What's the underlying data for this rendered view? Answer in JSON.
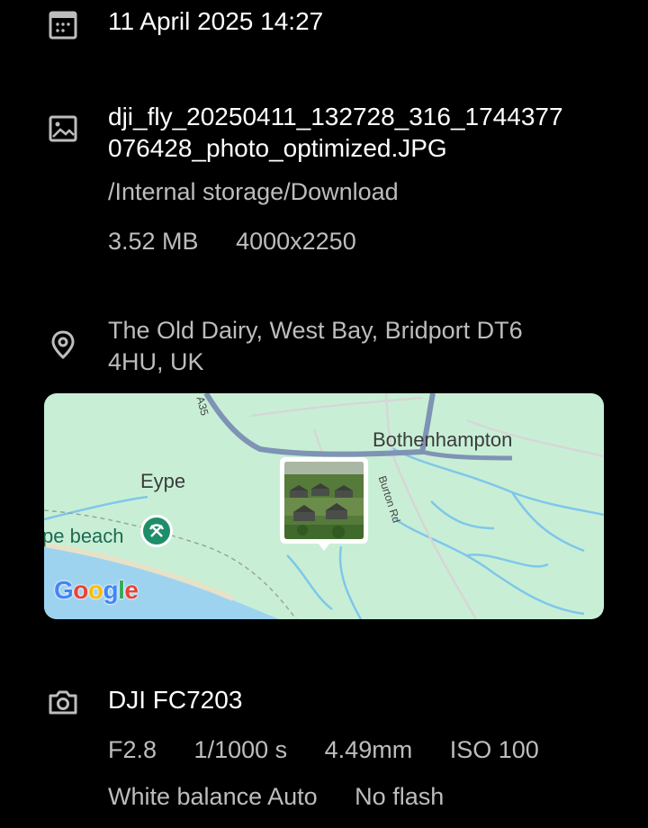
{
  "datetime": "11 April 2025 14:27",
  "file": {
    "name_line1": "dji_fly_20250411_132728_316_1744377",
    "name_line2": "076428_photo_optimized.JPG",
    "path": "/Internal storage/Download",
    "size": "3.52 MB",
    "resolution": "4000x2250"
  },
  "location": {
    "address_line1": "The Old Dairy, West Bay, Bridport DT6",
    "address_line2": "4HU, UK",
    "map_labels": {
      "bothenhampton": "Bothenhampton",
      "eype": "Eype",
      "beach": "pe beach",
      "road": "Burton Rd",
      "a35": "A35"
    },
    "google_letters": [
      {
        "ch": "G",
        "color": "#4285F4"
      },
      {
        "ch": "o",
        "color": "#EA4335"
      },
      {
        "ch": "o",
        "color": "#FBBC05"
      },
      {
        "ch": "g",
        "color": "#4285F4"
      },
      {
        "ch": "l",
        "color": "#34A853"
      },
      {
        "ch": "e",
        "color": "#EA4335"
      }
    ]
  },
  "camera": {
    "model": "DJI FC7203",
    "aperture": "F2.8",
    "shutter": "1/1000 s",
    "focal_length": "4.49mm",
    "iso": "ISO 100",
    "white_balance": "White balance Auto",
    "flash": "No flash"
  },
  "icons": {
    "date": "calendar-icon",
    "file": "image-icon",
    "location": "location-pin-icon",
    "camera": "camera-icon"
  },
  "colors": {
    "background": "#000000",
    "primary_text": "#ffffff",
    "secondary_text": "#bdbdbd",
    "map_land": "#c8efd6",
    "map_sea": "#9ed3f0",
    "map_marker": "#1e8e6a"
  }
}
